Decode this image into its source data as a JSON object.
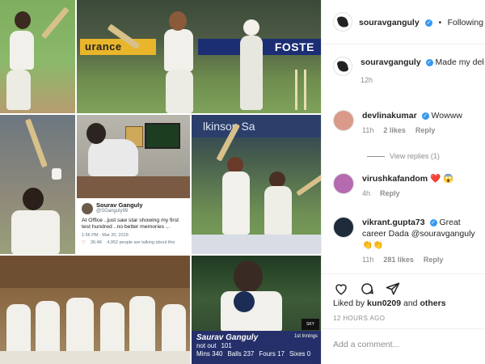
{
  "post": {
    "username": "souravganguly",
    "follow_status": "Following",
    "caption": "Made my debut today .. lifes best moment",
    "caption_age": "12h"
  },
  "collage": {
    "banner_left": "urance",
    "banner_right": "FOSTE",
    "tile5_banner": "lkinson Sa",
    "tweet": {
      "name": "Sourav Ganguly",
      "handle": "@SGanguly99",
      "text": "At Office ..just saw star showing my first test hundred ..no better memories ...",
      "time": "1:56 PM - Mar 20, 2018",
      "likes": "36.4K",
      "talking": "4,952 people are talking about this"
    },
    "scorecard": {
      "name": "Saurav Ganguly",
      "innings": "1st Innings",
      "status": "not out",
      "runs": "101",
      "mins": "Mins 340",
      "balls": "Balls 237",
      "fours": "Fours 17",
      "sixes": "Sixes 0",
      "logo": "SKY"
    }
  },
  "comments": [
    {
      "username": "devlinakumar",
      "text": "Wowww",
      "age": "11h",
      "likes": "2 likes",
      "reply": "Reply"
    },
    {
      "username": "virushkafandom",
      "text": "❤️ 😱",
      "age": "4h",
      "likes": "",
      "reply": "Reply"
    },
    {
      "username": "vikrant.gupta73",
      "text": "Great career Dada @souravganguly 👏👏",
      "age": "11h",
      "likes": "281 likes",
      "reply": "Reply"
    }
  ],
  "view_replies": "View replies (1)",
  "liked_by": {
    "prefix": "Liked by",
    "user": "kun0209",
    "joiner": "and",
    "others": "others"
  },
  "time_ago": "12 HOURS AGO",
  "add_comment_placeholder": "Add a comment..."
}
